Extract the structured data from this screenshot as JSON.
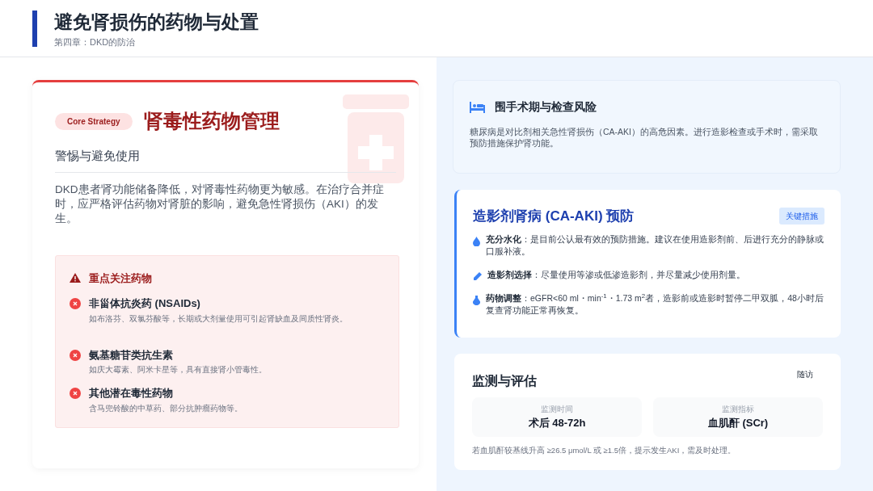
{
  "header": {
    "title": "避免肾损伤的药物与处置",
    "subtitle": "第四章：DKD的防治"
  },
  "strategy": {
    "tag": "Core Strategy",
    "title": "肾毒性药物管理",
    "subtitle": "警惕与避免使用",
    "body": "DKD患者肾功能储备降低，对肾毒性药物更为敏感。在治疗合并症时，应严格评估药物对肾脏的影响，避免急性肾损伤（AKI）的发生。",
    "alert": {
      "title": "重点关注药物",
      "items": [
        {
          "name": "非甾体抗炎药 (NSAIDs)",
          "detail": "如布洛芬、双氯芬酸等，长期或大剂量使用可引起肾缺血及间质性肾炎。"
        },
        {
          "name": "氨基糖苷类抗生素",
          "detail": "如庆大霉素、阿米卡星等，具有直接肾小管毒性。"
        },
        {
          "name": "其他潜在毒性药物",
          "detail": "含马兜铃酸的中草药、部分抗肿瘤药物等。"
        }
      ]
    }
  },
  "risk": {
    "title": "围手术期与检查风险",
    "body": "糖尿病是对比剂相关急性肾损伤（CA-AKI）的高危因素。进行造影检查或手术时，需采取预防措施保护肾功能。"
  },
  "prevention": {
    "title": "造影剂肾病 (CA-AKI) 预防",
    "badge": "关键措施",
    "items": [
      {
        "kind": "drop",
        "text": "**充分水化**：是目前公认最有效的预防措施。建议在使用造影剂前、后进行充分的静脉或口服补液。"
      },
      {
        "kind": "pen",
        "text": "**造影剂选择**：尽量使用等渗或低渗造影剂，并尽量减少使用剂量。"
      },
      {
        "kind": "pill",
        "text": "**药物调整**：eGFR<60 ml・min$^{-1}$・1.73 m$^{2}$者，造影前或造影时暂停二甲双胍，48小时后复查肾功能正常再恢复。"
      }
    ]
  },
  "monitoring": {
    "title": "监测与评估",
    "tag": "随访",
    "metrics": [
      {
        "label": "监测时间",
        "value": "术后 48-72h"
      },
      {
        "label": "监测指标",
        "value": "血肌酐 (SCr)"
      }
    ],
    "note": "若血肌酐较基线升高 ≥26.5 μmol/L 或 ≥1.5倍，提示发生AKI，需及时处理。"
  }
}
